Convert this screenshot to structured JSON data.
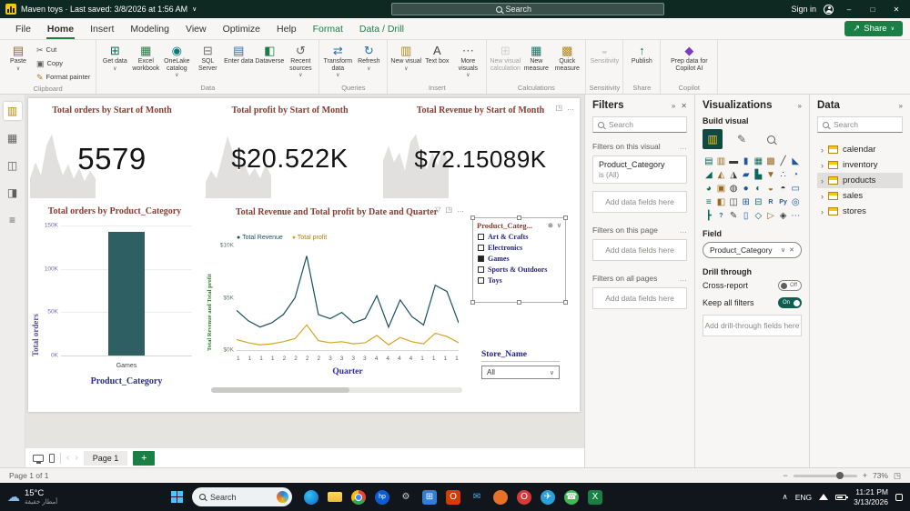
{
  "titlebar": {
    "title": "Maven toys · Last saved: 3/8/2026 at 1:56 AM",
    "search_placeholder": "Search",
    "sign_in": "Sign in"
  },
  "menubar": {
    "items": [
      {
        "label": "File",
        "state": "normal"
      },
      {
        "label": "Home",
        "state": "active"
      },
      {
        "label": "Insert",
        "state": "normal"
      },
      {
        "label": "Modeling",
        "state": "normal"
      },
      {
        "label": "View",
        "state": "normal"
      },
      {
        "label": "Optimize",
        "state": "normal"
      },
      {
        "label": "Help",
        "state": "normal"
      },
      {
        "label": "Format",
        "state": "contextual"
      },
      {
        "label": "Data / Drill",
        "state": "contextual"
      }
    ],
    "share_label": "Share"
  },
  "ribbon": {
    "groups": [
      {
        "label": "Clipboard",
        "buttons": [
          {
            "name": "paste",
            "label": "Paste",
            "glyph": "▤",
            "color": "#8a6d3b",
            "big": true,
            "caret": true
          },
          {
            "name": "cut",
            "label": "Cut",
            "glyph": "✂",
            "color": "#605e5c",
            "big": false
          },
          {
            "name": "copy",
            "label": "Copy",
            "glyph": "▣",
            "color": "#605e5c",
            "big": false
          },
          {
            "name": "format-painter",
            "label": "Format painter",
            "glyph": "✎",
            "color": "#b3761f",
            "big": false
          }
        ]
      },
      {
        "label": "Data",
        "buttons": [
          {
            "name": "get-data",
            "label": "Get data",
            "glyph": "⊞",
            "color": "#0a6e5c",
            "big": true,
            "caret": true
          },
          {
            "name": "excel-workbook",
            "label": "Excel workbook",
            "glyph": "▦",
            "color": "#1a7f45",
            "big": true
          },
          {
            "name": "onelake-catalog",
            "label": "OneLake catalog",
            "glyph": "◉",
            "color": "#0b787d",
            "big": true,
            "caret": true
          },
          {
            "name": "sql-server",
            "label": "SQL Server",
            "glyph": "⊟",
            "color": "#707070",
            "big": true
          },
          {
            "name": "enter-data",
            "label": "Enter data",
            "glyph": "▤",
            "color": "#2b6fb3",
            "big": true
          },
          {
            "name": "dataverse",
            "label": "Dataverse",
            "glyph": "◧",
            "color": "#1f7a4d",
            "big": true
          },
          {
            "name": "recent-sources",
            "label": "Recent sources",
            "glyph": "↺",
            "color": "#605e5c",
            "big": true,
            "caret": true
          }
        ]
      },
      {
        "label": "Queries",
        "buttons": [
          {
            "name": "transform-data",
            "label": "Transform data",
            "glyph": "⇄",
            "color": "#1f6fb3",
            "big": true,
            "caret": true
          },
          {
            "name": "refresh",
            "label": "Refresh",
            "glyph": "↻",
            "color": "#1f6fb3",
            "big": true,
            "caret": true
          }
        ]
      },
      {
        "label": "Insert",
        "buttons": [
          {
            "name": "new-visual",
            "label": "New visual",
            "glyph": "▥",
            "color": "#b3861f",
            "big": true,
            "caret": true
          },
          {
            "name": "text-box",
            "label": "Text box",
            "glyph": "A",
            "color": "#444444",
            "big": true
          },
          {
            "name": "more-visuals",
            "label": "More visuals",
            "glyph": "⋯",
            "color": "#605e5c",
            "big": true,
            "caret": true
          }
        ]
      },
      {
        "label": "Calculations",
        "buttons": [
          {
            "name": "new-visual-calculation",
            "label": "New visual calculation",
            "glyph": "⊞",
            "color": "#a6a6a6",
            "big": true,
            "disabled": true
          },
          {
            "name": "new-measure",
            "label": "New measure",
            "glyph": "▦",
            "color": "#117865",
            "big": true
          },
          {
            "name": "quick-measure",
            "label": "Quick measure",
            "glyph": "▩",
            "color": "#b3861f",
            "big": true
          }
        ]
      },
      {
        "label": "Sensitivity",
        "buttons": [
          {
            "name": "sensitivity",
            "label": "Sensitivity",
            "glyph": "◒",
            "color": "#a6a6a6",
            "big": true,
            "disabled": true
          }
        ]
      },
      {
        "label": "Share",
        "buttons": [
          {
            "name": "publish",
            "label": "Publish",
            "glyph": "↑",
            "color": "#117865",
            "big": true
          }
        ]
      },
      {
        "label": "Copilot",
        "buttons": [
          {
            "name": "prep-data-for-copilot",
            "label": "Prep data for Copilot AI",
            "glyph": "◆",
            "color": "#7a3fbf",
            "big": true,
            "wide": true
          }
        ]
      }
    ]
  },
  "sidebar": {
    "views": [
      {
        "name": "report-view",
        "glyph": "▥",
        "active": true
      },
      {
        "name": "table-view",
        "glyph": "▦",
        "active": false
      },
      {
        "name": "model-view",
        "glyph": "◫",
        "active": false
      },
      {
        "name": "dax-query-view",
        "glyph": "◨",
        "active": false
      },
      {
        "name": "tmdl-view",
        "glyph": "≡",
        "active": false
      }
    ]
  },
  "canvas": {
    "cards": [
      {
        "title": "Total orders by Start of Month",
        "value": "5579",
        "spark": [
          30,
          55,
          35,
          80,
          98,
          60,
          35,
          52,
          30,
          46,
          26,
          42,
          30
        ]
      },
      {
        "title": "Total profit by Start of Month",
        "value": "$20.522K",
        "spark": [
          25,
          42,
          30,
          62,
          95,
          70,
          40,
          56,
          34,
          46,
          30,
          52,
          34
        ]
      },
      {
        "title": "Total Revenue by Start of Month",
        "value": "$72.15089K",
        "spark": [
          58,
          80,
          55,
          70,
          42,
          86,
          98,
          64,
          44,
          70,
          50,
          76,
          54
        ]
      }
    ],
    "bar_chart": {
      "type": "bar",
      "title": "Total orders by Product_Category",
      "ylabel": "Total orders",
      "xlabel": "Product_Category",
      "yticks": [
        "150K",
        "100K",
        "50K",
        "0K"
      ],
      "ymax": 150,
      "categories": [
        "Games"
      ],
      "values": [
        143
      ],
      "bar_color": "#2e5f63"
    },
    "line_chart": {
      "type": "line",
      "title": "Total Revenue and Total profit by Date and Quarter",
      "ylabel": "Total Revenue and Total profit",
      "xlabel": "Quarter",
      "yticks": [
        "$10K",
        "$5K",
        "$0K"
      ],
      "ymax": 10,
      "x_categories": [
        "1",
        "1",
        "1",
        "1",
        "2",
        "2",
        "2",
        "2",
        "3",
        "3",
        "3",
        "3",
        "4",
        "4",
        "4",
        "4",
        "1",
        "1",
        "1",
        "1"
      ],
      "series": [
        {
          "name": "Total Revenue",
          "color": "#17505e",
          "values": [
            3.8,
            2.8,
            2.2,
            2.6,
            3.4,
            5.0,
            9.0,
            3.4,
            3.0,
            3.6,
            2.6,
            3.0,
            5.2,
            2.2,
            4.8,
            3.2,
            2.4,
            6.2,
            5.6,
            2.6
          ]
        },
        {
          "name": "Total profit",
          "color": "#d9a421",
          "values": [
            1.0,
            0.7,
            0.5,
            0.6,
            0.8,
            1.1,
            2.4,
            0.9,
            0.7,
            0.8,
            0.6,
            0.7,
            1.4,
            0.5,
            1.2,
            0.8,
            0.6,
            1.6,
            1.3,
            0.7
          ]
        }
      ]
    },
    "category_slicer": {
      "title": "Product_Categ...",
      "items": [
        {
          "label": "Art & Crafts",
          "checked": false
        },
        {
          "label": "Electronics",
          "checked": false
        },
        {
          "label": "Games",
          "checked": true
        },
        {
          "label": "Sports & Outdoors",
          "checked": false
        },
        {
          "label": "Toys",
          "checked": false
        }
      ]
    },
    "store_slicer": {
      "title": "Store_Name",
      "value": "All"
    }
  },
  "filters_panel": {
    "title": "Filters",
    "search_placeholder": "Search",
    "sections": [
      {
        "label": "Filters on this visual",
        "placeholder": "Add data fields here"
      },
      {
        "label": "Filters on this page",
        "placeholder": "Add data fields here"
      },
      {
        "label": "Filters on all pages",
        "placeholder": "Add data fields here"
      }
    ],
    "visual_filter": {
      "field": "Product_Category",
      "condition": "is (All)"
    }
  },
  "viz_panel": {
    "title": "Visualizations",
    "build_visual_label": "Build visual",
    "visual_types": [
      {
        "name": "stacked-bar-chart",
        "glyph": "▤"
      },
      {
        "name": "stacked-column-chart",
        "glyph": "▥"
      },
      {
        "name": "clustered-bar-chart",
        "glyph": "▬"
      },
      {
        "name": "clustered-column-chart",
        "glyph": "▮"
      },
      {
        "name": "100-stacked-bar-chart",
        "glyph": "▦"
      },
      {
        "name": "100-stacked-column-chart",
        "glyph": "▩"
      },
      {
        "name": "line-chart",
        "glyph": "╱"
      },
      {
        "name": "area-chart",
        "glyph": "◣"
      },
      {
        "name": "stacked-area-chart",
        "glyph": "◢"
      },
      {
        "name": "line-and-stacked-column-chart",
        "glyph": "◭"
      },
      {
        "name": "line-and-clustered-column-chart",
        "glyph": "◮"
      },
      {
        "name": "ribbon-chart",
        "glyph": "▰"
      },
      {
        "name": "waterfall-chart",
        "glyph": "▙"
      },
      {
        "name": "funnel-chart",
        "glyph": "▼"
      },
      {
        "name": "scatter-chart",
        "glyph": "∴"
      },
      {
        "name": "pie-chart",
        "glyph": "◔"
      },
      {
        "name": "donut-chart",
        "glyph": "◕"
      },
      {
        "name": "treemap",
        "glyph": "▣"
      },
      {
        "name": "map",
        "glyph": "◍"
      },
      {
        "name": "filled-map",
        "glyph": "●"
      },
      {
        "name": "shape-map",
        "glyph": "◐"
      },
      {
        "name": "azure-map",
        "glyph": "◒"
      },
      {
        "name": "gauge",
        "glyph": "◓"
      },
      {
        "name": "card",
        "glyph": "▭"
      },
      {
        "name": "multi-row-card",
        "glyph": "≡"
      },
      {
        "name": "kpi",
        "glyph": "◧"
      },
      {
        "name": "slicer",
        "glyph": "◫"
      },
      {
        "name": "table",
        "glyph": "⊞"
      },
      {
        "name": "matrix",
        "glyph": "⊟"
      },
      {
        "name": "r-script-visual",
        "glyph": "R"
      },
      {
        "name": "python-visual",
        "glyph": "Py"
      },
      {
        "name": "key-influencers",
        "glyph": "◎"
      },
      {
        "name": "decomposition-tree",
        "glyph": "┣"
      },
      {
        "name": "qa",
        "glyph": "?"
      },
      {
        "name": "smart-narrative",
        "glyph": "✎"
      },
      {
        "name": "paginated-report",
        "glyph": "▯"
      },
      {
        "name": "arcgis-map",
        "glyph": "◇"
      },
      {
        "name": "power-apps",
        "glyph": "▷"
      },
      {
        "name": "metrics",
        "glyph": "◈"
      },
      {
        "name": "more-visual-types",
        "glyph": "⋯"
      }
    ],
    "field_section_label": "Field",
    "field_pill": "Product_Category",
    "drill_through_label": "Drill through",
    "cross_report_label": "Cross-report",
    "cross_report_state": "Off",
    "keep_filters_label": "Keep all filters",
    "keep_filters_state": "On",
    "drill_placeholder": "Add drill-through fields here"
  },
  "data_panel": {
    "title": "Data",
    "search_placeholder": "Search",
    "tables": [
      {
        "name": "calendar",
        "selected": false
      },
      {
        "name": "inventory",
        "selected": false
      },
      {
        "name": "products",
        "selected": true
      },
      {
        "name": "sales",
        "selected": false
      },
      {
        "name": "stores",
        "selected": false
      }
    ]
  },
  "page_bar": {
    "active_page": "Page 1"
  },
  "status_bar": {
    "page_indicator": "Page 1 of 1",
    "zoom": "73%"
  },
  "taskbar": {
    "weather_temp": "15°C",
    "weather_desc": "أمطار خفيفة",
    "search_label": "Search",
    "apps": [
      {
        "name": "edge",
        "shape": "custom",
        "glyph": ""
      },
      {
        "name": "folder",
        "shape": "custom",
        "glyph": ""
      },
      {
        "name": "chrome",
        "shape": "custom",
        "glyph": ""
      },
      {
        "name": "hp",
        "shape": "circle",
        "color": "#0b5cd5",
        "glyph": "hp"
      },
      {
        "name": "settings",
        "shape": "none",
        "glyph": "⚙",
        "fg": "#c8cdd2"
      },
      {
        "name": "store",
        "shape": "square",
        "color": "#2f7fd6",
        "glyph": "⊞"
      },
      {
        "name": "office",
        "shape": "square",
        "color": "#d83b01",
        "glyph": "O"
      },
      {
        "name": "mail",
        "shape": "none",
        "glyph": "✉",
        "fg": "#5ab0f0"
      },
      {
        "name": "firefox",
        "shape": "circle",
        "color": "#e8702a",
        "glyph": ""
      },
      {
        "name": "opera",
        "shape": "circle",
        "color": "#d83a3a",
        "glyph": "O"
      },
      {
        "name": "telegram",
        "shape": "circle",
        "color": "#2ba0d8",
        "glyph": "✈"
      },
      {
        "name": "whatsapp",
        "shape": "circle",
        "color": "#3fba58",
        "glyph": "☎"
      },
      {
        "name": "excel",
        "shape": "square",
        "color": "#1a7f45",
        "glyph": "X"
      }
    ],
    "tray_lang": "ENG",
    "time": "11:21 PM",
    "date": "3/13/2026"
  }
}
